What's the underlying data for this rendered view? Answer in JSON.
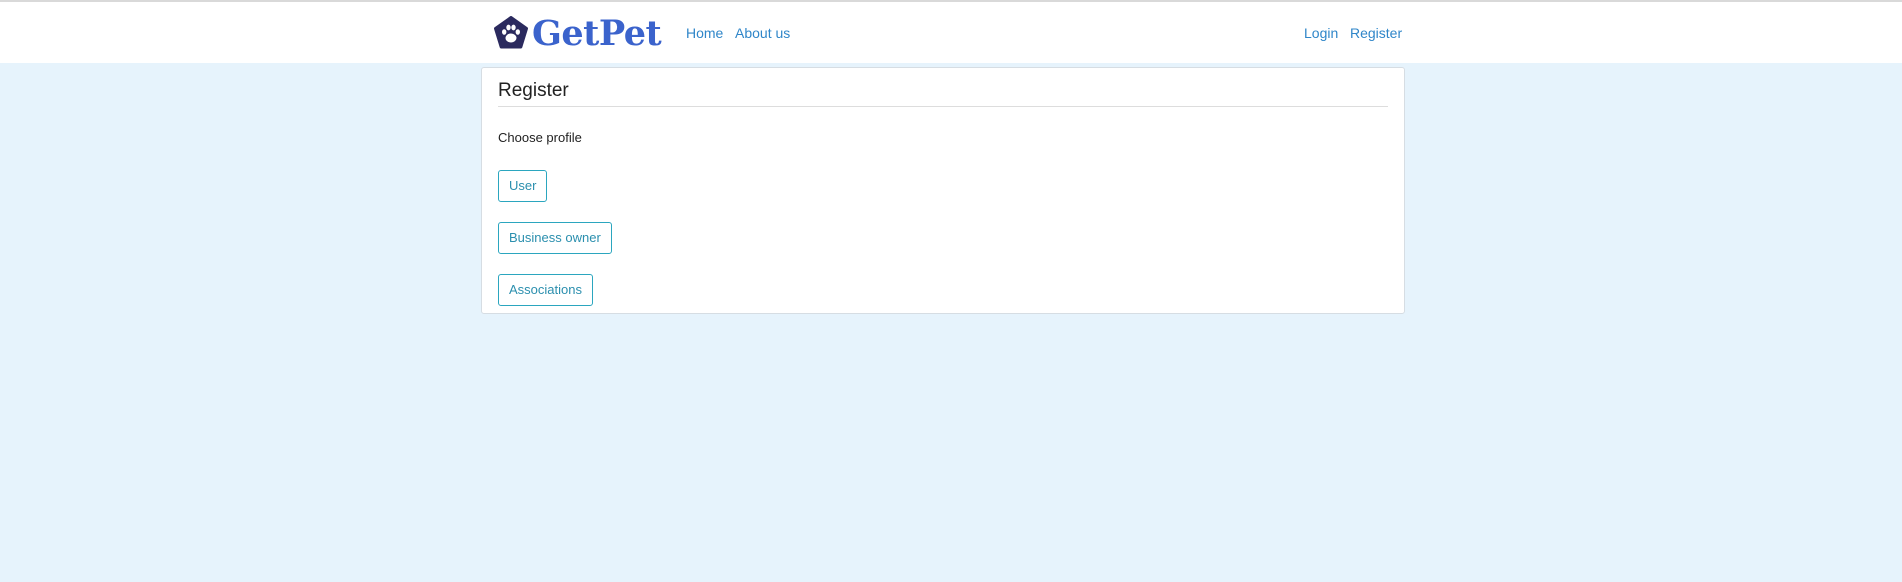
{
  "navbar": {
    "brand_name": "GetPet",
    "brand_icon": "paw-icon",
    "links": [
      {
        "label": "Home"
      },
      {
        "label": "About us"
      }
    ],
    "auth_links": [
      {
        "label": "Login"
      },
      {
        "label": "Register"
      }
    ]
  },
  "register_card": {
    "title": "Register",
    "subtitle": "Choose profile",
    "profile_options": [
      {
        "label": "User"
      },
      {
        "label": "Business owner"
      },
      {
        "label": "Associations"
      }
    ]
  },
  "colors": {
    "page_background": "#e6f3fc",
    "brand": "#3b63cc",
    "brand_icon": "#2b2a5e",
    "link": "#2f86c9",
    "button_outline": "#2ba6bf"
  }
}
